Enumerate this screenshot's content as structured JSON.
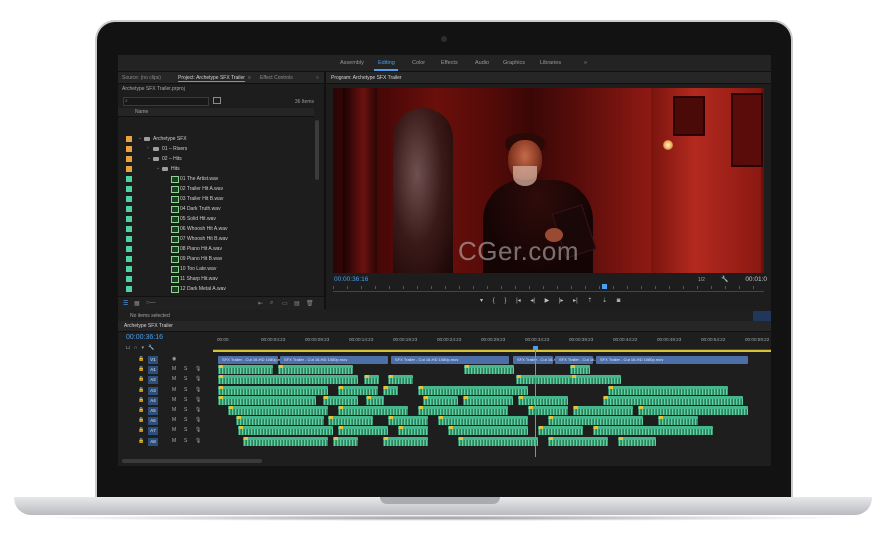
{
  "workspaces": [
    "Assembly",
    "Editing",
    "Color",
    "Effects",
    "Audio",
    "Graphics",
    "Libraries",
    "»"
  ],
  "project_panel": {
    "tabs": [
      "Source: (no clips)",
      "Project: Archetype SFX Trailer",
      "Effect Controls"
    ],
    "project_file": "Archetype SFX Trailer.prproj",
    "item_count": "36 Items",
    "column_name": "Name",
    "rows": [
      {
        "name": "Archetype SFX",
        "kind": "folder",
        "level": 0,
        "color": "#e8a33d"
      },
      {
        "name": "01 – Risers",
        "kind": "folder",
        "level": 1,
        "color": "#e8a33d"
      },
      {
        "name": "02 – Hits",
        "kind": "folder",
        "level": 1,
        "color": "#e8a33d"
      },
      {
        "name": "Hits",
        "kind": "folder",
        "level": 2,
        "color": "#e8a33d"
      },
      {
        "name": "01 The Artist.wav",
        "kind": "audio",
        "level": 3,
        "color": "#4fd3a0"
      },
      {
        "name": "02 Trailer Hit A.wav",
        "kind": "audio",
        "level": 3,
        "color": "#4fd3a0"
      },
      {
        "name": "03 Trailer Hit B.wav",
        "kind": "audio",
        "level": 3,
        "color": "#4fd3a0"
      },
      {
        "name": "04 Dark Truth.wav",
        "kind": "audio",
        "level": 3,
        "color": "#4fd3a0"
      },
      {
        "name": "05 Solid Hit.wav",
        "kind": "audio",
        "level": 3,
        "color": "#4fd3a0"
      },
      {
        "name": "06 Whoosh Hit A.wav",
        "kind": "audio",
        "level": 3,
        "color": "#4fd3a0"
      },
      {
        "name": "07 Whoosh Hit B.wav",
        "kind": "audio",
        "level": 3,
        "color": "#4fd3a0"
      },
      {
        "name": "08 Piano Hit A.wav",
        "kind": "audio",
        "level": 3,
        "color": "#4fd3a0"
      },
      {
        "name": "09 Piano Hit B.wav",
        "kind": "audio",
        "level": 3,
        "color": "#4fd3a0"
      },
      {
        "name": "10 Too Late.wav",
        "kind": "audio",
        "level": 3,
        "color": "#4fd3a0"
      },
      {
        "name": "11 Sharp Hit.wav",
        "kind": "audio",
        "level": 3,
        "color": "#4fd3a0"
      },
      {
        "name": "12 Dark Metal A.wav",
        "kind": "audio",
        "level": 3,
        "color": "#4fd3a0"
      },
      {
        "name": "13 Dark Metal B.wav",
        "kind": "audio",
        "level": 3,
        "color": "#4fd3a0"
      }
    ]
  },
  "program_monitor": {
    "title": "Program: Archetype SFX Trailer",
    "timecode": "00:00:36:16",
    "fit": "1/2",
    "duration": "00:01:0",
    "watermark": "CGer.com"
  },
  "selection_status": "No items selected",
  "timeline": {
    "title": "Archetype SFX Trailer",
    "timecode": "00:00:36:16",
    "ticks": [
      "00:00",
      "00:00:04:23",
      "00:00:09:23",
      "00:00:14:23",
      "00:00:19:23",
      "00:00:24:23",
      "00:00:29:23",
      "00:00:34:23",
      "00:00:39:23",
      "00:00:44:22",
      "00:00:49:23",
      "00:00:54:22",
      "00:00:59:22"
    ],
    "video_clip_label": "SFX Trailer - Cut 16-HD 1080p.mov",
    "tracks": [
      "V1",
      "A1",
      "A2",
      "A3",
      "A4",
      "A5",
      "A6",
      "A7",
      "A8"
    ],
    "track_controls": {
      "mute": "M",
      "solo": "S"
    }
  },
  "colors": {
    "accent": "#4a9ff0",
    "audio_clip": "#48b68c",
    "video_clip": "#4d6fa8",
    "folder_label": "#e8a33d",
    "audio_label": "#4fd3a0"
  }
}
